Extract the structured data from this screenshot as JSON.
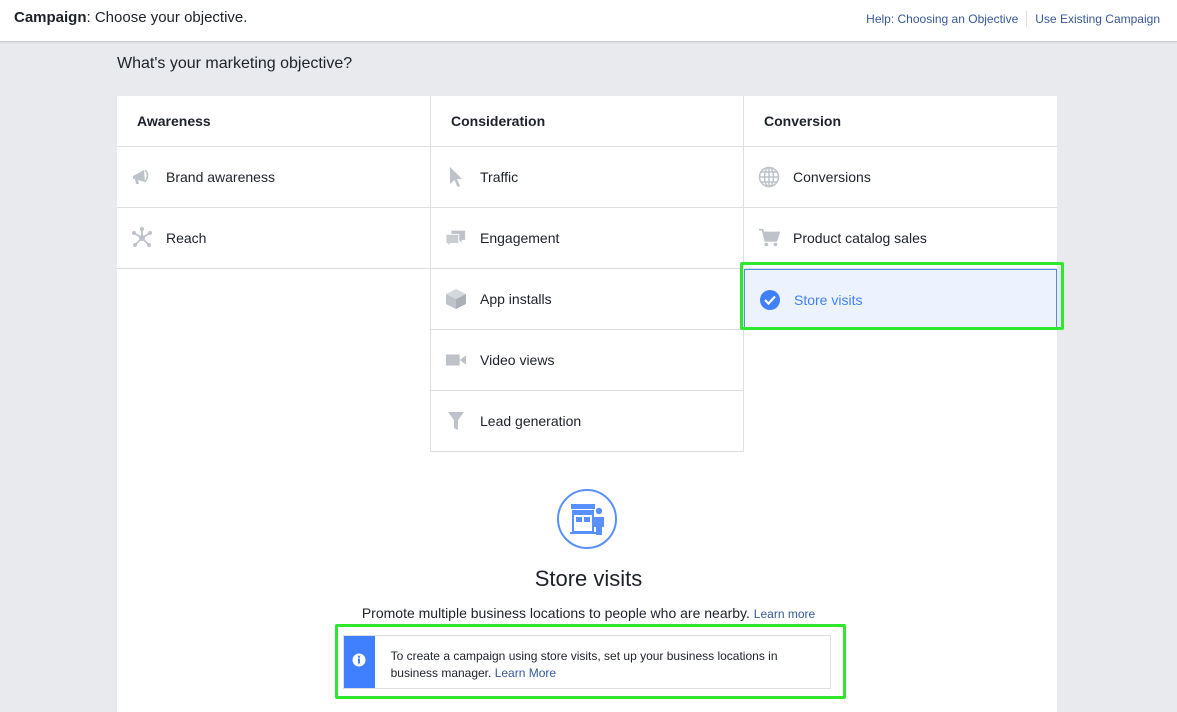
{
  "header": {
    "title_bold": "Campaign",
    "title_rest": ": Choose your objective.",
    "help_link": "Help: Choosing an Objective",
    "existing_link": "Use Existing Campaign"
  },
  "question": "What's your marketing objective?",
  "columns": {
    "awareness": {
      "header": "Awareness",
      "items": [
        {
          "label": "Brand awareness",
          "icon": "megaphone-icon"
        },
        {
          "label": "Reach",
          "icon": "reach-icon"
        }
      ]
    },
    "consideration": {
      "header": "Consideration",
      "items": [
        {
          "label": "Traffic",
          "icon": "cursor-icon"
        },
        {
          "label": "Engagement",
          "icon": "chat-bubbles-icon"
        },
        {
          "label": "App installs",
          "icon": "box-icon"
        },
        {
          "label": "Video views",
          "icon": "video-camera-icon"
        },
        {
          "label": "Lead generation",
          "icon": "funnel-icon"
        }
      ]
    },
    "conversion": {
      "header": "Conversion",
      "items": [
        {
          "label": "Conversions",
          "icon": "globe-icon"
        },
        {
          "label": "Product catalog sales",
          "icon": "cart-icon"
        },
        {
          "label": "Store visits",
          "icon": "check-circle-icon",
          "selected": true
        }
      ]
    }
  },
  "detail": {
    "icon": "store-icon",
    "title": "Store visits",
    "description": "Promote multiple business locations to people who are nearby.",
    "learn_more": "Learn more"
  },
  "notice": {
    "icon": "info-icon",
    "text": "To create a campaign using store visits, set up your business locations in business manager.",
    "link": "Learn More"
  },
  "colors": {
    "accent": "#4080ff",
    "link": "#365899",
    "highlight": "#2de82d",
    "icon_gray": "#bec2c9"
  }
}
